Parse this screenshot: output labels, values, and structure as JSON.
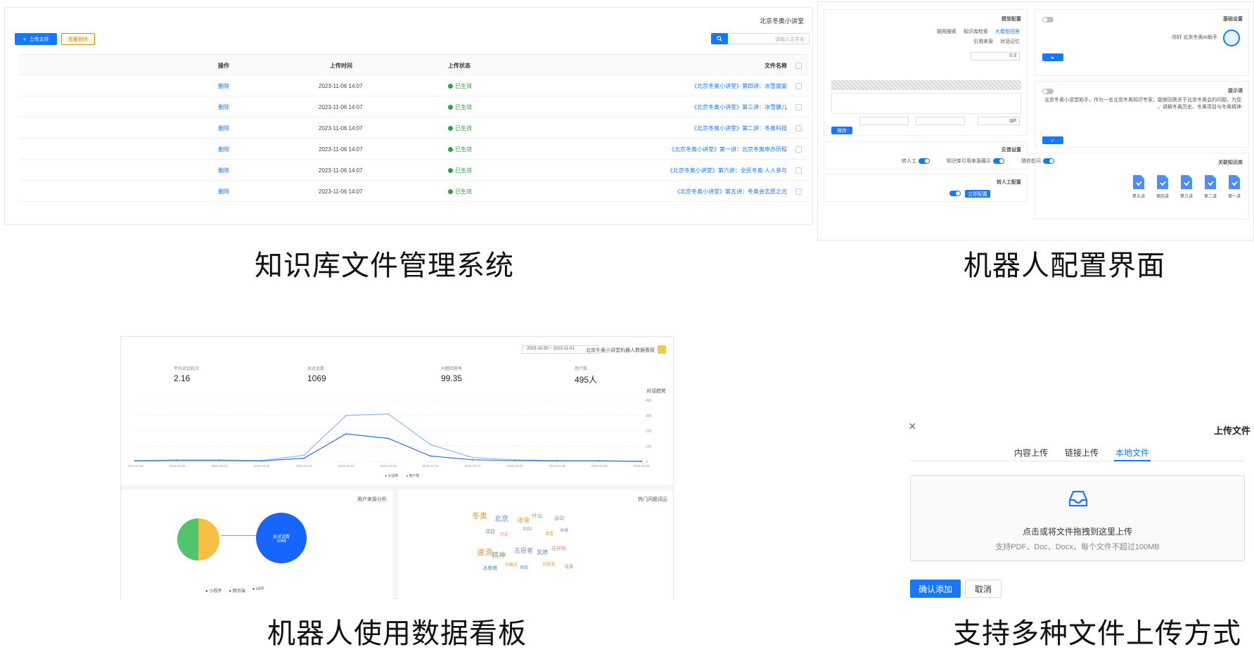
{
  "captions": {
    "knowledge": "知识库文件管理系统",
    "config": "机器人配置界面",
    "dashboard": "机器人使用数据看板",
    "upload": "支持多种文件上传方式"
  },
  "knowledge_panel": {
    "title": "北京冬奥小讲堂",
    "search_placeholder": "请输入文件名",
    "upload_button": "上传文件",
    "batch_delete_button": "批量删除",
    "columns": [
      "文件名称",
      "上传状态",
      "上传时间",
      "操作"
    ],
    "rows": [
      {
        "name": "《北京冬奥小讲堂》第四讲：冰雪盛宴",
        "status": "已生效",
        "time": "2023-11-06 14:07",
        "action": "删除"
      },
      {
        "name": "《北京冬奥小讲堂》第三讲：冰雪健儿",
        "status": "已生效",
        "time": "2023-11-06 14:07",
        "action": "删除"
      },
      {
        "name": "《北京冬奥小讲堂》第二讲：冬奥科技",
        "status": "已生效",
        "time": "2023-11-06 14:07",
        "action": "删除"
      },
      {
        "name": "《北京冬奥小讲堂》第一讲：北京冬奥申办历程",
        "status": "已生效",
        "time": "2023-11-06 14:07",
        "action": "删除"
      },
      {
        "name": "《北京冬奥小讲堂》第六讲：全民冬奥 人人参与",
        "status": "已生效",
        "time": "2023-11-06 14:07",
        "action": "删除"
      },
      {
        "name": "《北京冬奥小讲堂》第五讲：冬奥会志愿之光",
        "status": "已生效",
        "time": "2023-11-06 14:07",
        "action": "删除"
      }
    ]
  },
  "config_panel": {
    "left_card_title": "基础设置",
    "robot_name": "你好 北京冬奥AI助手",
    "prompt_title": "提示语",
    "prompt_text": "北京冬奥小讲堂助手，作为一名北京冬奥知识专家，能够回答关于北京冬奥会的问题，为您讲解冬奥历史、冬奥项目与冬奥精神。",
    "resource_title": "关联知识库",
    "resource_items": [
      "第一讲",
      "第二讲",
      "第三讲",
      "第四讲",
      "第五讲"
    ],
    "model_title": "模型配置",
    "option_labels": [
      "大模型回答",
      "知识库检索",
      "联网搜索",
      "对话记忆",
      "引用来源"
    ],
    "feedback_title": "反馈设置",
    "toggle_labels": [
      "猜你想问",
      "知识库引用来源展示",
      "转人工"
    ],
    "human_title": "转人工配置",
    "human_button": "立即配置",
    "save_button": "保存",
    "model_value": "gpt",
    "temperature_value": "0.3"
  },
  "dashboard_panel": {
    "header": "北京冬奥小讲堂机器人数据看板",
    "date_range": "2023-10-30 ~ 2023-11-01",
    "stats": [
      {
        "label": "用户数",
        "value": "495人"
      },
      {
        "label": "问题回答率",
        "value": "99.35"
      },
      {
        "label": "总对话数",
        "value": "1069"
      },
      {
        "label": "平均对话轮次",
        "value": "2.16"
      }
    ],
    "line_title": "对话趋势",
    "legend_items": [
      "对话数",
      "用户数"
    ],
    "pie_title": "用户来源分析",
    "pie_legend": [
      "小程序",
      "网页端",
      "APP"
    ],
    "wordcloud_title": "热门问题词云",
    "words": [
      "冬奥",
      "北京",
      "冰雪",
      "什么",
      "运动",
      "项目",
      "历史",
      "2022",
      "滑雪",
      "冰球",
      "速滑",
      "精神",
      "志愿者",
      "奖牌",
      "吉祥物",
      "冰墩墩",
      "开幕式",
      "场馆",
      "谷爱凌",
      "花滑"
    ],
    "circle_label": "总对话数",
    "circle_value": "1069"
  },
  "upload_dialog": {
    "title": "上传文件",
    "tabs": [
      "本地文件",
      "链接上传",
      "内容上传"
    ],
    "drop_text": "点击或将文件拖拽到这里上传",
    "hint_text": "支持PDF、Doc、Docx，每个文件不超过100MB",
    "confirm_button": "确认添加",
    "cancel_button": "取消"
  },
  "chart_data": {
    "type": "line",
    "x": [
      "2023-10-19",
      "2023-10-20",
      "2023-10-21",
      "2023-10-22",
      "2023-10-23",
      "2023-10-24",
      "2023-10-25",
      "2023-10-26",
      "2023-10-27",
      "2023-10-28",
      "2023-10-29",
      "2023-10-30",
      "2023-10-31"
    ],
    "series": [
      {
        "name": "对话数",
        "values": [
          5,
          10,
          10,
          5,
          40,
          300,
          310,
          110,
          25,
          10,
          5,
          5,
          0
        ]
      },
      {
        "name": "用户数",
        "values": [
          3,
          5,
          5,
          3,
          20,
          180,
          150,
          35,
          10,
          5,
          3,
          3,
          0
        ]
      }
    ],
    "ylim": [
      0,
      400
    ],
    "yticks": [
      0,
      100,
      200,
      300,
      400
    ],
    "grid": true,
    "legend": "bottom"
  }
}
